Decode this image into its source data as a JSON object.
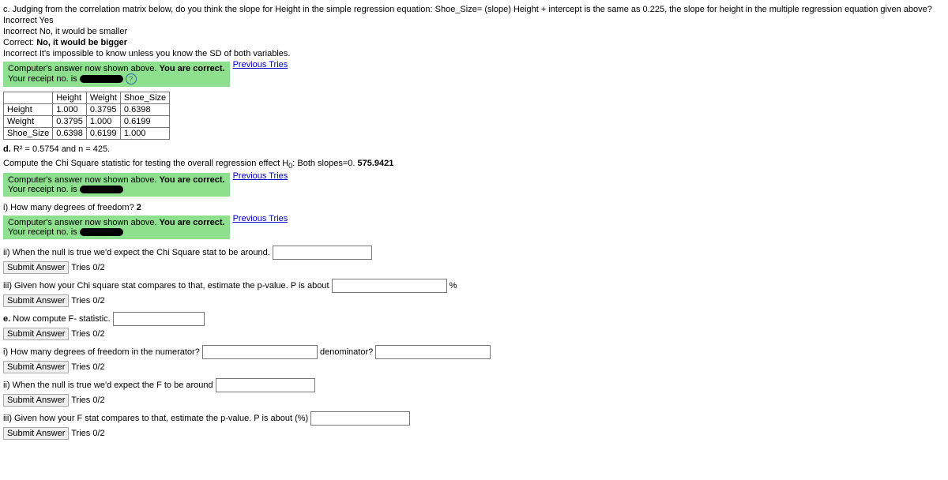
{
  "qC": {
    "prompt": "c. Judging from the correlation matrix below, do you think the slope for Height in the simple regression equation: Shoe_Size= (slope) Height + intercept is the same as 0.225, the slope for height in the multiple regression equation given above?",
    "opt1": "Incorrect Yes",
    "opt2": "Incorrect No, it would be smaller",
    "opt3pre": "Correct: ",
    "opt3bold": "No, it would be bigger",
    "opt4": "Incorrect It's impossible to know unless you know the SD of both variables."
  },
  "greenbox": {
    "line1a": "Computer's answer now shown above. ",
    "line1b": "You are correct.",
    "line2": "Your receipt no. is"
  },
  "prev_tries": "Previous Tries",
  "corr": {
    "h1": "Height",
    "h2": "Weight",
    "h3": "Shoe_Size",
    "r1": "Height",
    "r2": "Weight",
    "r3": "Shoe_Size",
    "v11": "1.000",
    "v12": "0.3795",
    "v13": "0.6398",
    "v21": "0.3795",
    "v22": "1.000",
    "v23": "0.6199",
    "v31": "0.6398",
    "v32": "0.6199",
    "v33": "1.000"
  },
  "qD": {
    "rsq_line_pre": "d. ",
    "rsq_line": "R² = 0.5754 and n = 425.",
    "compute_prompt_pre": "Compute the Chi Square statistic for testing the overall regression effect H",
    "compute_prompt_sub": "0",
    "compute_prompt_post": ": Both slopes=0. ",
    "compute_answer": "575.9421"
  },
  "qDi": {
    "prompt_pre": "i) How many degrees of freedom? ",
    "answer": "2"
  },
  "qDii": {
    "prompt": "ii) When the null is true we'd expect the Chi Square stat to be around."
  },
  "qDiii": {
    "prompt": "iii) Given how your Chi square stat compares to that, estimate the p-value. P is about",
    "unit": "%"
  },
  "qE": {
    "prompt": "e. Now compute F- statistic."
  },
  "qEi": {
    "prompt": "i) How many degrees of freedom in the numerator?",
    "denom_label": "denominator?"
  },
  "qEii": {
    "prompt": "ii) When the null is true we'd expect the F to be around"
  },
  "qEiii": {
    "prompt": "iii) Given how your F stat compares to that, estimate the p-value. P is about  (%)"
  },
  "submit": {
    "label": "Submit Answer",
    "tries": "Tries 0/2"
  },
  "help_icon": "?"
}
